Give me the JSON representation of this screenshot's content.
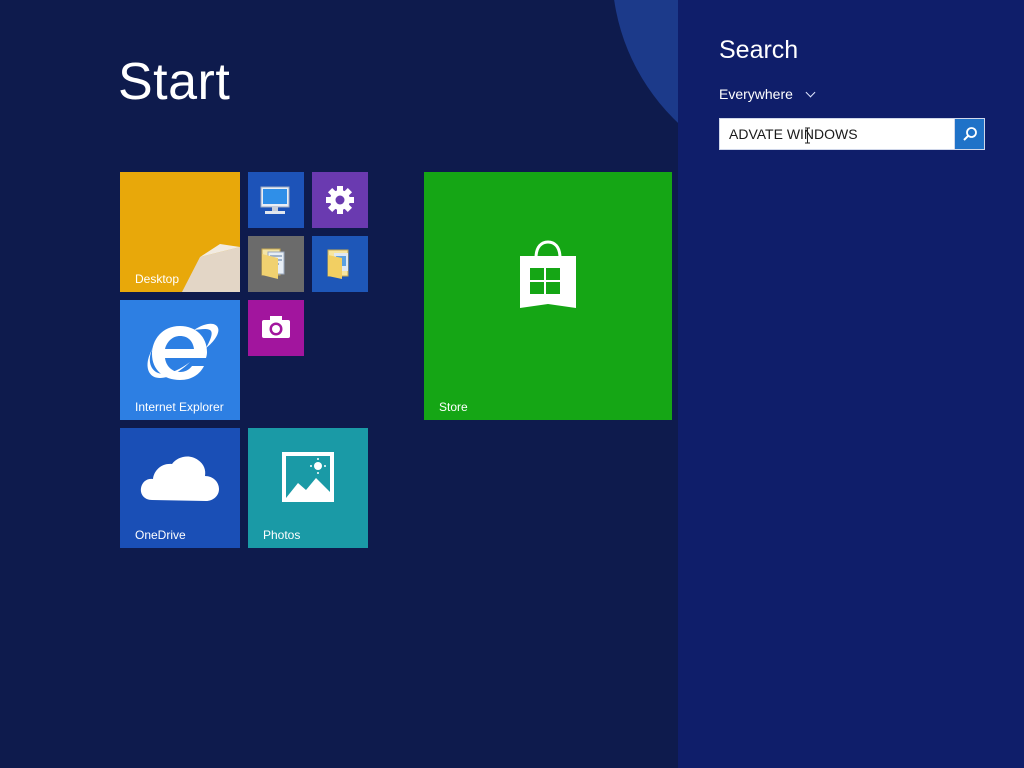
{
  "start": {
    "title": "Start",
    "tiles": {
      "desktop": "Desktop",
      "internet_explorer": "Internet Explorer",
      "onedrive": "OneDrive",
      "photos": "Photos",
      "store": "Store"
    }
  },
  "search": {
    "title": "Search",
    "scope": "Everywhere",
    "query": "ADVATE WINDOWS"
  },
  "icons": {
    "desktop": "desktop-background-icon",
    "this_pc": "computer-monitor-icon",
    "pc_settings": "gear-icon",
    "files": "folder-icon",
    "file_explorer": "folder-icon",
    "camera": "camera-icon",
    "ie": "internet-explorer-icon",
    "onedrive": "cloud-icon",
    "photos": "picture-icon",
    "store": "shopping-bag-icon",
    "search_button": "search-icon",
    "scope_dropdown": "chevron-down-icon"
  },
  "colors": {
    "background": "#0e1b4d",
    "search_panel": "#0f1e6a",
    "desktop_tile": "#e8a80a",
    "settings_tile": "#6a3ab0",
    "camera_tile": "#a2159e",
    "ie_tile": "#2d7fe3",
    "onedrive_tile": "#1a4fb6",
    "photos_tile": "#1a9aa6",
    "store_tile": "#15a615",
    "search_button": "#1f72c8"
  }
}
